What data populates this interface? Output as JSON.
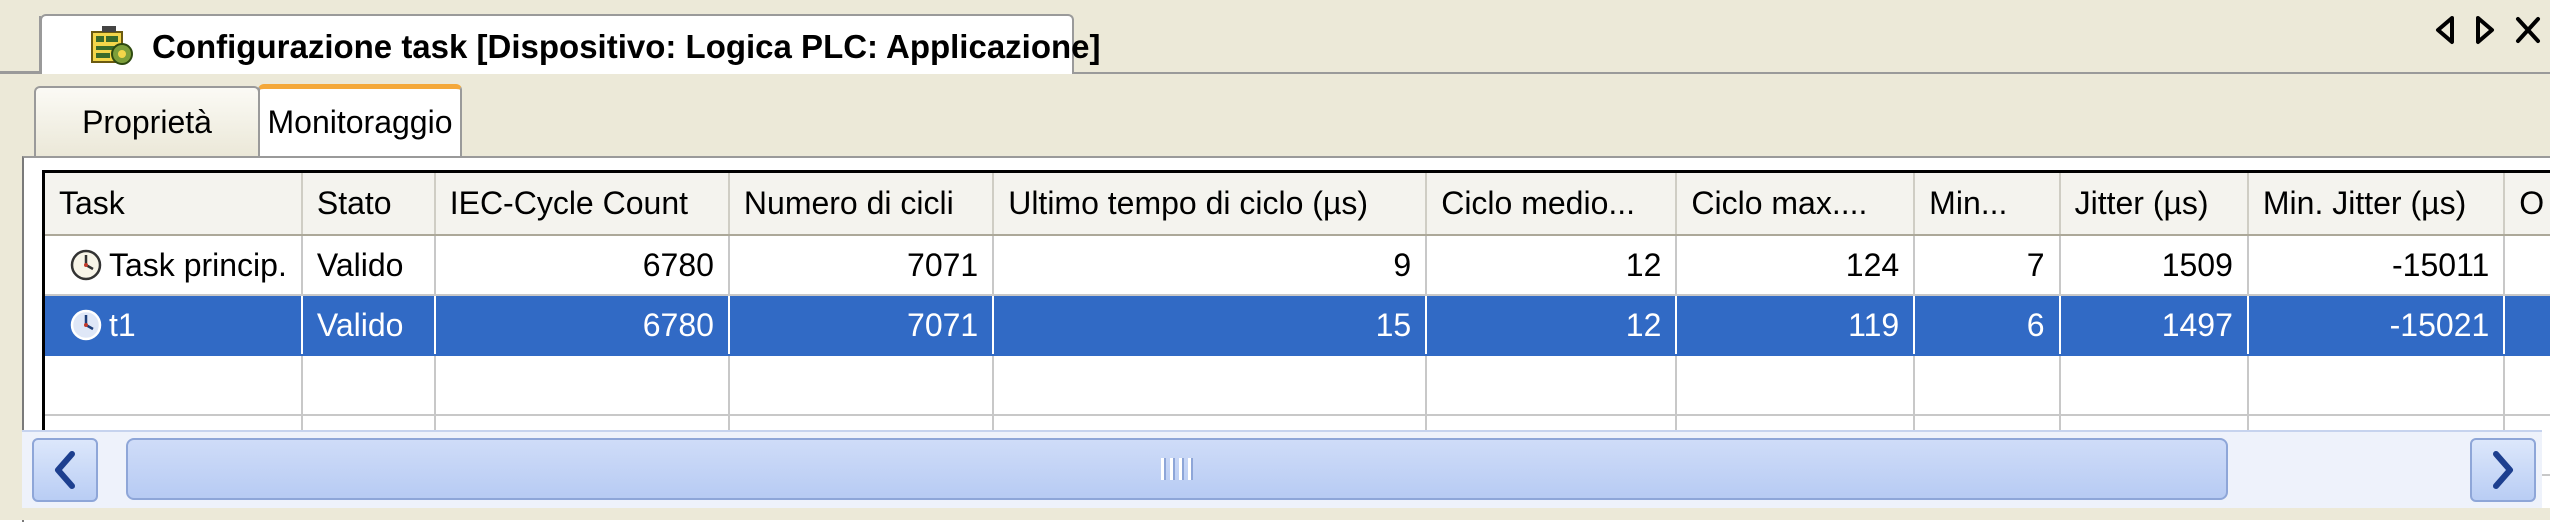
{
  "window": {
    "title": "Configurazione task [Dispositivo: Logica PLC: Applicazione]",
    "icon": "task-config-icon"
  },
  "nav": {
    "prev_icon": "triangle-left-icon",
    "next_icon": "triangle-right-icon",
    "close_icon": "close-icon"
  },
  "tabs": [
    {
      "label": "Proprietà",
      "active": false
    },
    {
      "label": "Monitoraggio",
      "active": true
    }
  ],
  "grid": {
    "columns": [
      "Task",
      "Stato",
      "IEC-Cycle Count",
      "Numero di cicli",
      "Ultimo tempo di ciclo (µs)",
      "Ciclo medio...",
      "Ciclo max....",
      "Min...",
      "Jitter (µs)",
      "Min. Jitter (µs)",
      "O"
    ],
    "rows": [
      {
        "task": "Task princip.",
        "stato": "Valido",
        "iec_cycle_count": "6780",
        "numero_cicli": "7071",
        "ultimo_tempo": "9",
        "ciclo_medio": "12",
        "ciclo_max": "124",
        "min": "7",
        "jitter": "1509",
        "min_jitter": "-15011",
        "selected": false
      },
      {
        "task": "t1",
        "stato": "Valido",
        "iec_cycle_count": "6780",
        "numero_cicli": "7071",
        "ultimo_tempo": "15",
        "ciclo_medio": "12",
        "ciclo_max": "119",
        "min": "6",
        "jitter": "1497",
        "min_jitter": "-15021",
        "selected": true
      }
    ]
  },
  "scrollbar": {
    "left_icon": "chevron-left-icon",
    "right_icon": "chevron-right-icon",
    "grip_icon": "grip-icon"
  },
  "colors": {
    "selection": "#316ac5",
    "tab_accent": "#f4a83a",
    "chrome": "#ece9d8"
  }
}
